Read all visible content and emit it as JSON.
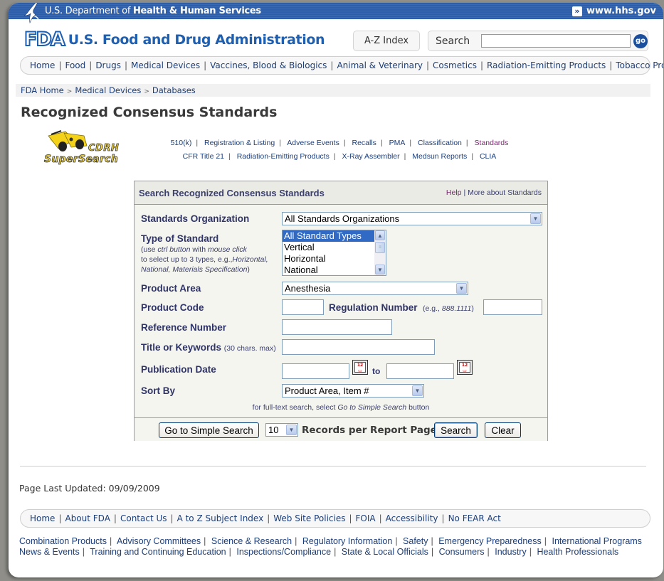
{
  "hhs_bar": {
    "prefix": "U.S. Department of",
    "department": "Health & Human Services",
    "link_label": "www.hhs.gov"
  },
  "header": {
    "logo_mark": "FDA",
    "agency_name": "U.S. Food and Drug Administration",
    "az_index_label": "A-Z Index",
    "search_label": "Search",
    "search_value": "",
    "go_label": "go"
  },
  "main_nav": [
    "Home",
    "Food",
    "Drugs",
    "Medical Devices",
    "Vaccines, Blood & Biologics",
    "Animal & Veterinary",
    "Cosmetics",
    "Radiation-Emitting Products",
    "Tobacco Products"
  ],
  "breadcrumb": [
    "FDA Home",
    "Medical Devices",
    "Databases"
  ],
  "page_title": "Recognized Consensus Standards",
  "supersearch": {
    "line1": "CDRH",
    "line2": "SuperSearch"
  },
  "cdrh_links": {
    "row1": [
      "510(k)",
      "Registration & Listing",
      "Adverse Events",
      "Recalls",
      "PMA",
      "Classification",
      "Standards"
    ],
    "row2": [
      "CFR Title 21",
      "Radiation-Emitting Products",
      "X-Ray Assembler",
      "Medsun Reports",
      "CLIA"
    ],
    "active": "Standards"
  },
  "form": {
    "title": "Search Recognized Consensus Standards",
    "help_label": "Help",
    "more_label": "More about Standards",
    "standards_org": {
      "label": "Standards Organization",
      "value": "All Standards Organizations"
    },
    "type_of_standard": {
      "label": "Type of Standard",
      "note_1a": "(use ",
      "note_1b": "ctrl button",
      "note_1c": " with ",
      "note_1d": "mouse click",
      "note_2a": "to select up to 3 types, e.g.,",
      "note_2b": "Horizontal,",
      "note_3a": "National, Materials Specification",
      "note_3b": ")",
      "options": [
        "All Standard Types",
        "Vertical",
        "Horizontal",
        "National"
      ],
      "selected": "All Standard Types"
    },
    "product_area": {
      "label": "Product Area",
      "value": "Anesthesia"
    },
    "product_code": {
      "label": "Product Code",
      "value": ""
    },
    "regulation_number": {
      "label": "Regulation Number",
      "hint_prefix": "(e.g., ",
      "hint_example": "888.1111",
      "hint_suffix": ")",
      "value": ""
    },
    "reference_number": {
      "label": "Reference Number",
      "value": ""
    },
    "title_keywords": {
      "label": "Title or Keywords",
      "hint": "(30 chars. max)",
      "value": ""
    },
    "publication_date": {
      "label": "Publication Date",
      "from": "",
      "to_label": "to",
      "to": ""
    },
    "sort_by": {
      "label": "Sort By",
      "value": "Product Area, Item #"
    },
    "fulltext_note": {
      "prefix": "for full-text search, select ",
      "emph": "Go to Simple Search",
      "suffix": " button"
    },
    "footer": {
      "simple_search_label": "Go to Simple Search",
      "records_value": "10",
      "records_label": "Records per Report Page",
      "search_label": "Search",
      "clear_label": "Clear"
    }
  },
  "page_updated": "Page Last Updated: 09/09/2009",
  "footer_nav": [
    "Home",
    "About FDA",
    "Contact Us",
    "A to Z Subject Index",
    "Web Site Policies",
    "FOIA",
    "Accessibility",
    "No FEAR Act"
  ],
  "bottom_links": {
    "row1": [
      "Combination Products",
      "Advisory Committees",
      "Science & Research",
      "Regulatory Information",
      "Safety",
      "Emergency Preparedness",
      "International Programs"
    ],
    "row2": [
      "News & Events",
      "Training and Continuing Education",
      "Inspections/Compliance",
      "State & Local Officials",
      "Consumers",
      "Industry",
      "Health Professionals"
    ]
  },
  "colors": {
    "hhs_blue": "#2e5ea8",
    "fda_blue": "#1f5fb0",
    "link_navy": "#1c3e7a",
    "label_navy": "#2f3468",
    "active_purple": "#7a2a6f",
    "select_highlight": "#316ac5"
  }
}
